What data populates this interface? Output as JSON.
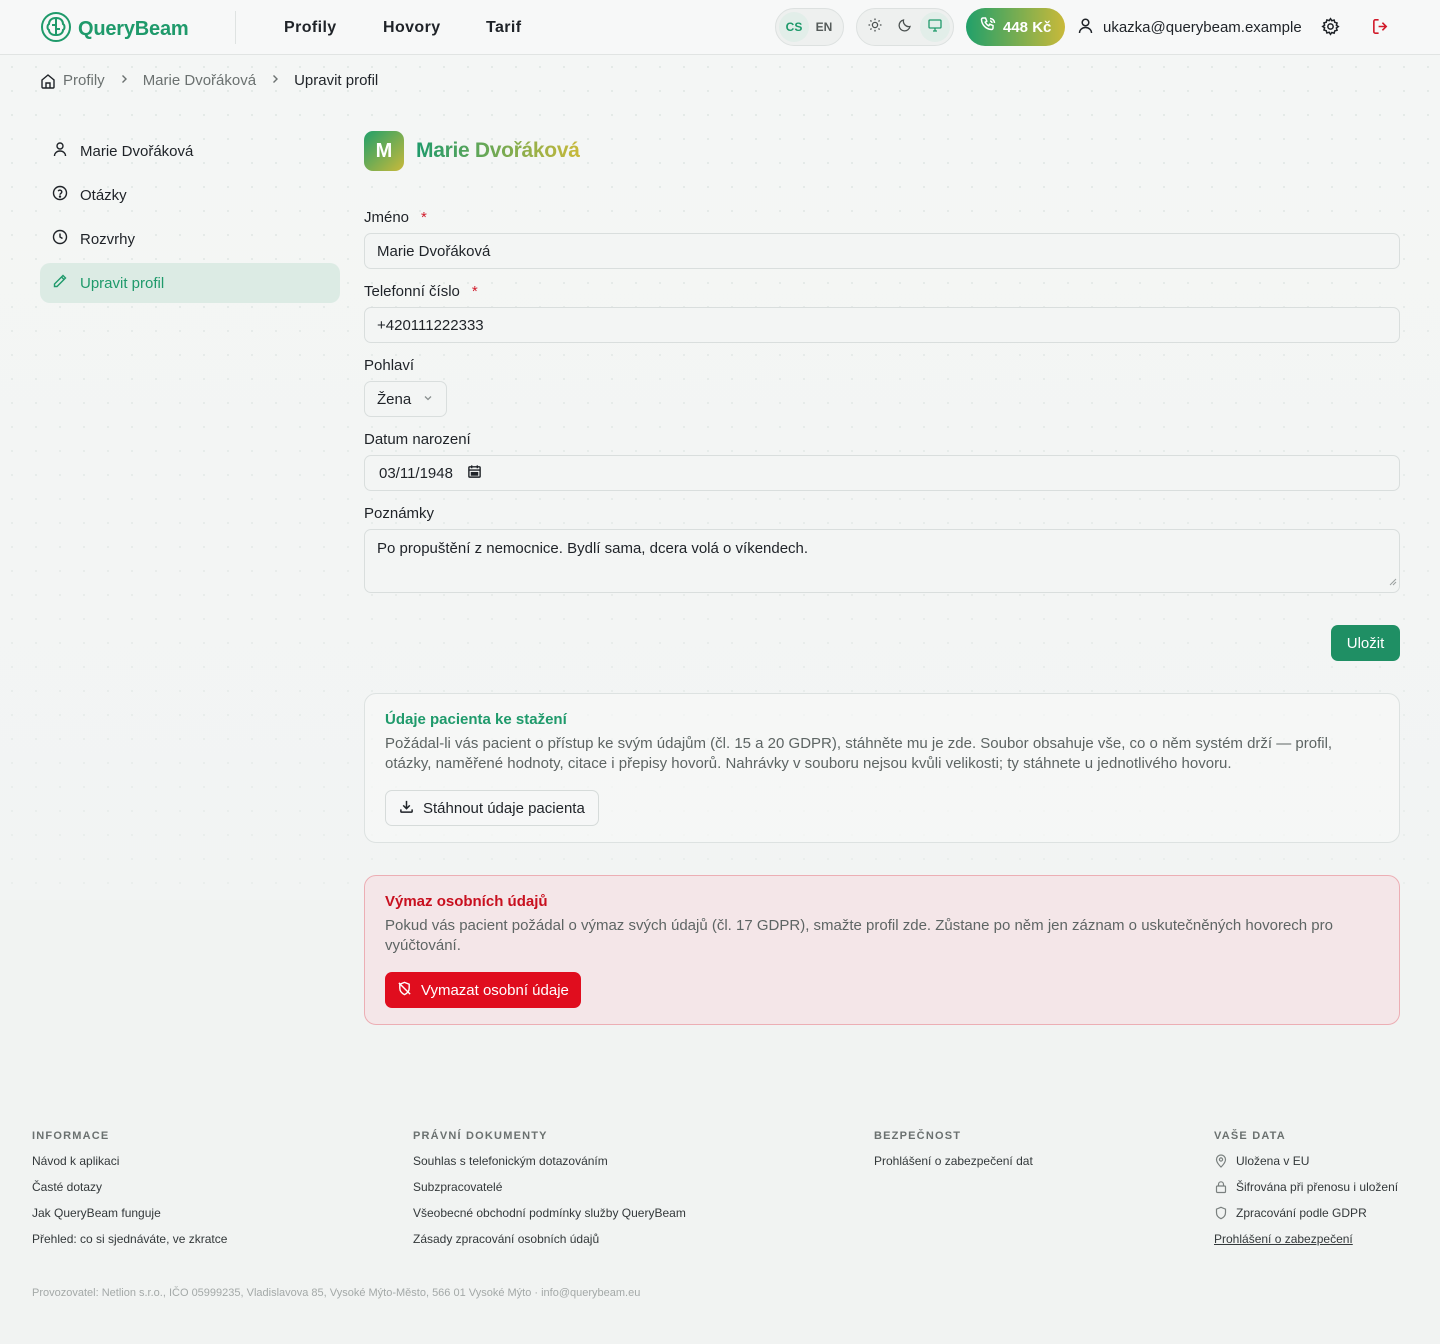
{
  "header": {
    "logo": "QueryBeam",
    "nav": [
      "Profily",
      "Hovory",
      "Tarif"
    ],
    "languages": [
      "CS",
      "EN"
    ],
    "active_language": "CS",
    "theme_options": [
      "sun-icon",
      "moon-icon",
      "monitor-icon"
    ],
    "active_theme": "monitor-icon",
    "credit": "448 Kč",
    "user_email": "ukazka@querybeam.example"
  },
  "breadcrumb": {
    "items": [
      "Profily",
      "Marie Dvořáková",
      "Upravit profil"
    ]
  },
  "sidebar": {
    "items": [
      {
        "label": "Marie Dvořáková",
        "icon": "user-icon"
      },
      {
        "label": "Otázky",
        "icon": "question-icon"
      },
      {
        "label": "Rozvrhy",
        "icon": "clock-icon"
      },
      {
        "label": "Upravit profil",
        "icon": "pencil-icon",
        "active": true
      }
    ]
  },
  "profile": {
    "initial": "M",
    "name": "Marie Dvořáková"
  },
  "form": {
    "name_label": "Jméno",
    "name_value": "Marie Dvořáková",
    "phone_label": "Telefonní číslo",
    "phone_value": "+420111222333",
    "required_mark": "*",
    "gender_label": "Pohlaví",
    "gender_value": "Žena",
    "birth_label": "Datum narození",
    "birth_value": "03/11/1948",
    "notes_label": "Poznámky",
    "notes_value": "Po propuštění z nemocnice. Bydlí sama, dcera volá o víkendech.",
    "save_label": "Uložit"
  },
  "export_card": {
    "title": "Údaje pacienta ke stažení",
    "text": "Požádal-li vás pacient o přístup ke svým údajům (čl. 15 a 20 GDPR), stáhněte mu je zde. Soubor obsahuje vše, co o něm systém drží — profil, otázky, naměřené hodnoty, citace i přepisy hovorů. Nahrávky v souboru nejsou kvůli velikosti; ty stáhnete u jednotlivého hovoru.",
    "button": "Stáhnout údaje pacienta"
  },
  "delete_card": {
    "title": "Výmaz osobních údajů",
    "text": "Pokud vás pacient požádal o výmaz svých údajů (čl. 17 GDPR), smažte profil zde. Zůstane po něm jen záznam o uskutečněných hovorech pro vyúčtování.",
    "button": "Vymazat osobní údaje"
  },
  "footer": {
    "info": {
      "heading": "INFORMACE",
      "links": [
        "Návod k aplikaci",
        "Časté dotazy",
        "Jak QueryBeam funguje",
        "Přehled: co si sjednáváte, ve zkratce"
      ]
    },
    "legal_docs": {
      "heading": "PRÁVNÍ DOKUMENTY",
      "links": [
        "Souhlas s telefonickým dotazováním",
        "Subzpracovatelé",
        "Všeobecné obchodní podmínky služby QueryBeam",
        "Zásady zpracování osobních údajů"
      ]
    },
    "security": {
      "heading": "BEZPEČNOST",
      "links": [
        "Prohlášení o zabezpečení dat"
      ]
    },
    "your_data": {
      "heading": "VAŠE DATA",
      "items": [
        {
          "label": "Uložena v EU",
          "icon": "map-pin-icon"
        },
        {
          "label": "Šifrována při přenosu i uložení",
          "icon": "lock-icon"
        },
        {
          "label": "Zpracování podle GDPR",
          "icon": "shield-icon"
        }
      ],
      "link": "Prohlášení o zabezpečení"
    },
    "operator": "Provozovatel: Netlion s.r.o., IČO 05999235, Vladislavova 85, Vysoké Mýto-Město, 566 01 Vysoké Mýto · info@querybeam.eu"
  },
  "colors": {
    "brand_green": "#1f9a6b",
    "brand_gold": "#c9b93a",
    "danger": "#e00d1e"
  }
}
